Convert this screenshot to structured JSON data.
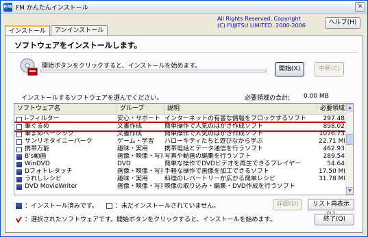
{
  "window": {
    "title": "FM かんたんインストール",
    "icon_label": "FM",
    "close": "✕"
  },
  "copyright": {
    "line1": "All Rights Reserved, Copyright",
    "line2": "(C) FUJITSU LIMITED. 2000-2006"
  },
  "help_button": "ヘルプ(H)",
  "tabs": [
    {
      "label": "インストール",
      "active": true
    },
    {
      "label": "アンインストール",
      "active": false
    }
  ],
  "heading": "ソフトウェアをインストールします。",
  "install": {
    "hint": "開始ボタンをクリックすると、インストールを始めます。",
    "start_button": "開始(X)",
    "stop_button": "中断(C)",
    "progress": 0
  },
  "selection": {
    "prompt": "インストールするソフトウェアを選んでください。",
    "required_label": "必要領域の合計:",
    "required_value": "0.00 MB"
  },
  "list": {
    "columns": [
      "ソフトウェア名",
      "グループ",
      "説明",
      "必要領域"
    ],
    "rows": [
      {
        "name": "i-フィルター",
        "group": "安心・サポート",
        "desc": "インターネットの有害な情報をブロックするソフト",
        "size": "297.48",
        "state": "not-installed"
      },
      {
        "name": "筆ぐるめ",
        "group": "文書作成",
        "desc": "簡単操作で人気のはがき作成ソフト",
        "size": "898.02",
        "state": "not-installed",
        "selected": true
      },
      {
        "name": "筆まめベーシック",
        "group": "文書作成",
        "desc": "簡単操作で人気のはがき作成ソフト",
        "size": "1076.73",
        "state": "not-installed"
      },
      {
        "name": "サンリオタイニーパーク",
        "group": "ゲーム・学習",
        "desc": "ハローキティたちと遊びながら学ぶ",
        "size": "22.71 MB",
        "state": "not-installed"
      },
      {
        "name": "携帯万能",
        "group": "趣味・実用",
        "desc": "携帯電話とデータ通信を行うソフト",
        "size": "462.93",
        "state": "not-installed"
      },
      {
        "name": "B's動画",
        "group": "画像・映像・写真",
        "desc": "写真や動画の編集を行うソフト",
        "size": "289.54",
        "state": "installed"
      },
      {
        "name": "WinDVD",
        "group": "DVD",
        "desc": "簡単な操作でDVDビデオを再生できるプレイヤー",
        "size": "54.64",
        "state": "installed"
      },
      {
        "name": "Dフォトレタッチ",
        "group": "画像・映像・写真",
        "desc": "手軽な操作で画像を加工できるソフト",
        "size": "17.50 MB",
        "state": "installed"
      },
      {
        "name": "うれしレシピ",
        "group": "趣味・実用",
        "desc": "料理のレパートリーが広がる簡単レシピ",
        "size": "31.78 MB",
        "state": "installed"
      },
      {
        "name": "DVD MovieWriter",
        "group": "画像・映像・写真",
        "desc": "映像の取り込み・編集・DVD作成を行うソフト",
        "size": "",
        "state": "installed"
      }
    ]
  },
  "legend": {
    "installed": "：インストール済みです。",
    "not_installed": "：未だインストールされていません。",
    "selected": "：選択されたソフトウェアです。開始ボタンをクリックすると、インストールを始めます。"
  },
  "buttons": {
    "detail": "詳細(D)",
    "relist": "リスト再表示(L)",
    "end": "終了(Q)"
  },
  "colors": {
    "highlight": "#e50000",
    "title_accent": "#0000cc"
  }
}
